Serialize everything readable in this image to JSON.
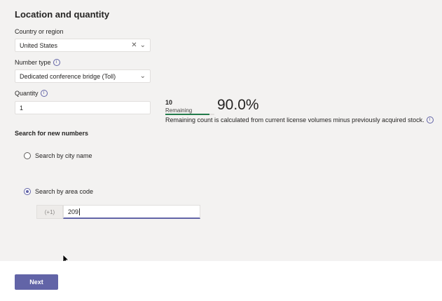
{
  "section_title": "Location and quantity",
  "country": {
    "label": "Country or region",
    "value": "United States",
    "clear_glyph": "✕",
    "chevron_glyph": "⌄"
  },
  "number_type": {
    "label": "Number type",
    "value": "Dedicated conference bridge (Toll)",
    "chevron_glyph": "⌄",
    "info_glyph": "i"
  },
  "quantity": {
    "label": "Quantity",
    "value": "1",
    "info_glyph": "i"
  },
  "remaining": {
    "count": "10",
    "label": "Remaining",
    "percent": "90.0%",
    "bar_fill_fraction": 0.9,
    "note": "Remaining count is calculated from current license volumes minus previously acquired stock.",
    "info_glyph": "i"
  },
  "search": {
    "heading": "Search for new numbers",
    "option_city": "Search by city name",
    "option_area": "Search by area code",
    "selected": "area",
    "prefix": "(+1)",
    "area_code_value": "209"
  },
  "footer": {
    "next_label": "Next"
  },
  "colors": {
    "accent": "#6264a7",
    "bar_fill": "#237b4b",
    "background": "#f3f2f1"
  }
}
